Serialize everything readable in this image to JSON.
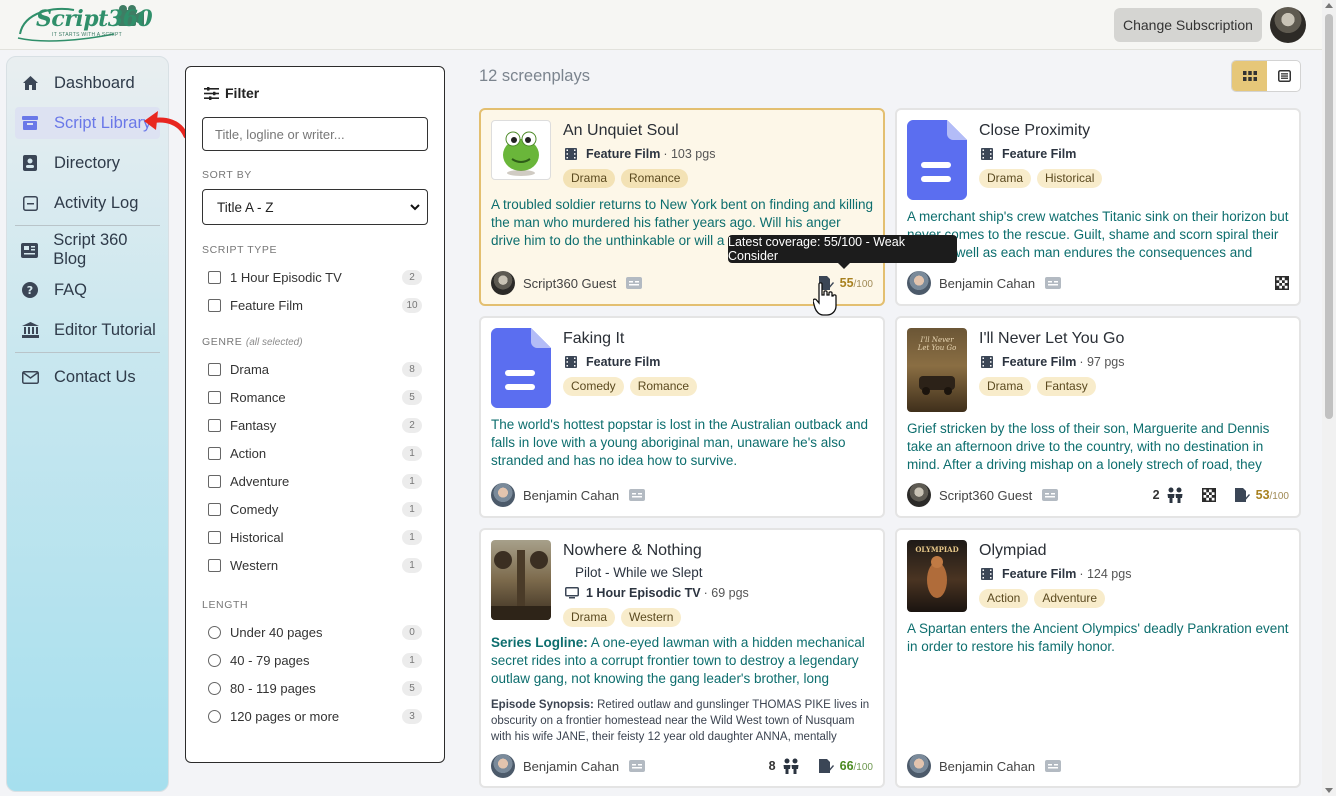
{
  "header": {
    "logo_text": "Script360",
    "logo_tagline": "IT STARTS WITH A SCRIPT",
    "change_subscription": "Change Subscription"
  },
  "sidebar": {
    "items": [
      {
        "label": "Dashboard",
        "icon": "home-icon"
      },
      {
        "label": "Script Library",
        "icon": "library-icon",
        "active": true
      },
      {
        "label": "Directory",
        "icon": "address-book-icon"
      },
      {
        "label": "Activity Log",
        "icon": "activity-icon"
      },
      {
        "label": "Script 360 Blog",
        "icon": "newspaper-icon"
      },
      {
        "label": "FAQ",
        "icon": "question-icon"
      },
      {
        "label": "Editor Tutorial",
        "icon": "bank-icon"
      },
      {
        "label": "Contact Us",
        "icon": "envelope-icon"
      }
    ]
  },
  "filter": {
    "title": "Filter",
    "search_placeholder": "Title, logline or writer...",
    "sort_label": "SORT BY",
    "sort_value": "Title A - Z",
    "script_type_label": "SCRIPT TYPE",
    "script_types": [
      {
        "label": "1 Hour Episodic TV",
        "count": "2"
      },
      {
        "label": "Feature Film",
        "count": "10"
      }
    ],
    "genre_label": "GENRE",
    "genre_note": "(all selected)",
    "genres": [
      {
        "label": "Drama",
        "count": "8"
      },
      {
        "label": "Romance",
        "count": "5"
      },
      {
        "label": "Fantasy",
        "count": "2"
      },
      {
        "label": "Action",
        "count": "1"
      },
      {
        "label": "Adventure",
        "count": "1"
      },
      {
        "label": "Comedy",
        "count": "1"
      },
      {
        "label": "Historical",
        "count": "1"
      },
      {
        "label": "Western",
        "count": "1"
      }
    ],
    "length_label": "LENGTH",
    "lengths": [
      {
        "label": "Under 40 pages",
        "count": "0"
      },
      {
        "label": "40 - 79 pages",
        "count": "1"
      },
      {
        "label": "80 - 119 pages",
        "count": "5"
      },
      {
        "label": "120 pages or more",
        "count": "3"
      }
    ]
  },
  "main": {
    "result_count": "12 screenplays",
    "tooltip": "Latest coverage: 55/100 - Weak Consider",
    "cards": [
      {
        "title": "An Unquiet Soul",
        "type": "Feature Film",
        "pages": "· 103 pgs",
        "tags": [
          "Drama",
          "Romance"
        ],
        "logline": "A troubled soldier returns to New York bent on finding and killing the man who murdered his father years ago. Will his anger drive him to do the unthinkable or will a new love and the chance of forgiveness",
        "author": "Script360 Guest",
        "score": "55",
        "score_max": "/100"
      },
      {
        "title": "Close Proximity",
        "type": "Feature Film",
        "pages": "",
        "tags": [
          "Drama",
          "Historical"
        ],
        "logline": "A merchant ship's crew watches Titanic sink on their horizon but never comes to the rescue. Guilt, shame and scorn spiral their lives as well as each man endures the consequences and searches f...",
        "author": "Benjamin Cahan"
      },
      {
        "title": "Faking It",
        "type": "Feature Film",
        "pages": "",
        "tags": [
          "Comedy",
          "Romance"
        ],
        "logline": "The world's hottest popstar is lost in the Australian outback and falls in love with a young aboriginal man, unaware he's also stranded and has no idea how to survive.",
        "author": "Benjamin Cahan"
      },
      {
        "title": "I'll Never Let You Go",
        "type": "Feature Film",
        "pages": "· 97 pgs",
        "tags": [
          "Drama",
          "Fantasy"
        ],
        "logline": "Grief stricken by the loss of their son, Marguerite and Dennis take an afternoon drive to the country, with no destination in mind. After a driving mishap on a lonely strech of road, they happen upon a quain...",
        "author": "Script360 Guest",
        "people": "2",
        "score": "53",
        "score_max": "/100"
      },
      {
        "title": "Nowhere & Nothing",
        "subtitle": "Pilot - While we Slept",
        "type": "1 Hour Episodic TV",
        "pages": "· 69 pgs",
        "tags": [
          "Drama",
          "Western"
        ],
        "series_label": "Series Logline:",
        "logline": "A one-eyed lawman with a hidden mechanical secret rides into a corrupt frontier town to destroy a legendary outlaw gang, not knowing the gang leader's brother, long presumed dead, is hidin...",
        "synopsis_label": "Episode Synopsis:",
        "synopsis": "Retired outlaw and gunslinger THOMAS PIKE lives in obscurity on a frontier homestead near the Wild West town of Nusquam with his wife JANE, their feisty 12 year old daughter ANNA, mentally challenged 14...",
        "author": "Benjamin Cahan",
        "people": "8",
        "score": "66",
        "score_max": "/100"
      },
      {
        "title": "Olympiad",
        "type": "Feature Film",
        "pages": "· 124 pgs",
        "tags": [
          "Action",
          "Adventure"
        ],
        "logline": "A Spartan enters the Ancient Olympics' deadly Pankration event in order to restore his family honor.",
        "author": "Benjamin Cahan"
      }
    ]
  },
  "colors": {
    "accent": "#6a78e8",
    "logline": "#0d6e6e",
    "tag_bg": "#f8eccb",
    "highlight_border": "#e3bf70",
    "arrow": "#e8261f"
  }
}
